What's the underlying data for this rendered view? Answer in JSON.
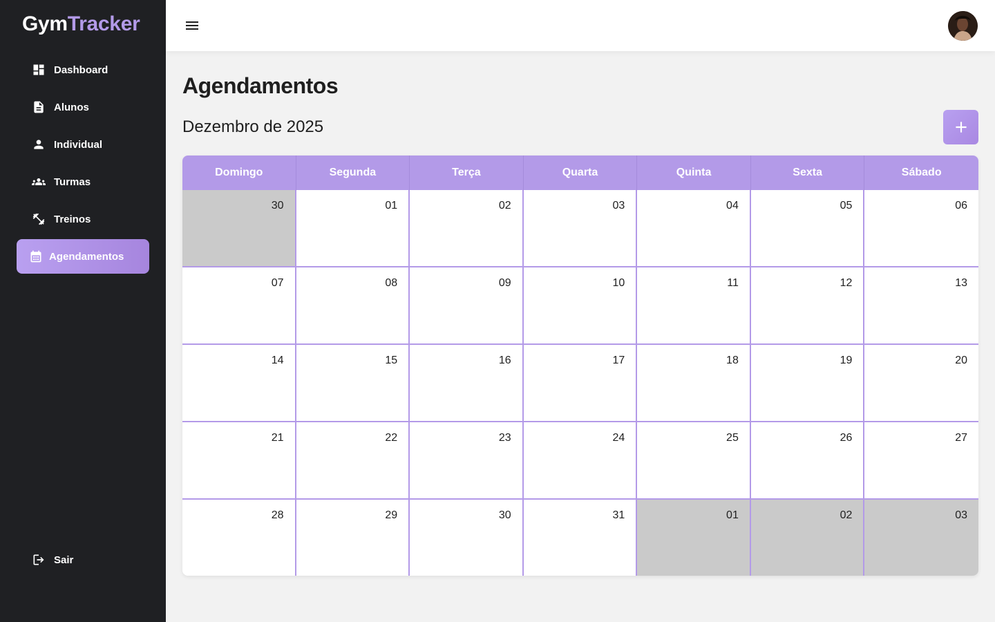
{
  "app": {
    "logo_part1": "Gym",
    "logo_part2": "Tracker",
    "brand_color": "#b39ae8"
  },
  "sidebar": {
    "items": [
      {
        "label": "Dashboard",
        "icon": "dashboard-icon",
        "active": false
      },
      {
        "label": "Alunos",
        "icon": "document-icon",
        "active": false
      },
      {
        "label": "Individual",
        "icon": "person-icon",
        "active": false
      },
      {
        "label": "Turmas",
        "icon": "group-icon",
        "active": false
      },
      {
        "label": "Treinos",
        "icon": "dumbbell-icon",
        "active": false
      },
      {
        "label": "Agendamentos",
        "icon": "calendar-icon",
        "active": true
      }
    ],
    "logout_label": "Sair"
  },
  "header": {
    "menu_icon": "hamburger-menu-icon",
    "avatar": "user-avatar"
  },
  "main": {
    "title": "Agendamentos",
    "month_label": "Dezembro de 2025",
    "add_icon": "plus-icon"
  },
  "calendar": {
    "weekdays": [
      "Domingo",
      "Segunda",
      "Terça",
      "Quarta",
      "Quinta",
      "Sexta",
      "Sábado"
    ],
    "weeks": [
      [
        {
          "day": "30",
          "outside": true
        },
        {
          "day": "01"
        },
        {
          "day": "02"
        },
        {
          "day": "03"
        },
        {
          "day": "04"
        },
        {
          "day": "05"
        },
        {
          "day": "06"
        }
      ],
      [
        {
          "day": "07"
        },
        {
          "day": "08"
        },
        {
          "day": "09"
        },
        {
          "day": "10"
        },
        {
          "day": "11"
        },
        {
          "day": "12"
        },
        {
          "day": "13"
        }
      ],
      [
        {
          "day": "14"
        },
        {
          "day": "15"
        },
        {
          "day": "16"
        },
        {
          "day": "17"
        },
        {
          "day": "18"
        },
        {
          "day": "19"
        },
        {
          "day": "20"
        }
      ],
      [
        {
          "day": "21"
        },
        {
          "day": "22"
        },
        {
          "day": "23"
        },
        {
          "day": "24"
        },
        {
          "day": "25"
        },
        {
          "day": "26"
        },
        {
          "day": "27"
        }
      ],
      [
        {
          "day": "28"
        },
        {
          "day": "29"
        },
        {
          "day": "30"
        },
        {
          "day": "31"
        },
        {
          "day": "01",
          "outside": true
        },
        {
          "day": "02",
          "outside": true
        },
        {
          "day": "03",
          "outside": true
        }
      ]
    ],
    "header_color": "#b39ae8",
    "outside_color": "#cacaca"
  }
}
